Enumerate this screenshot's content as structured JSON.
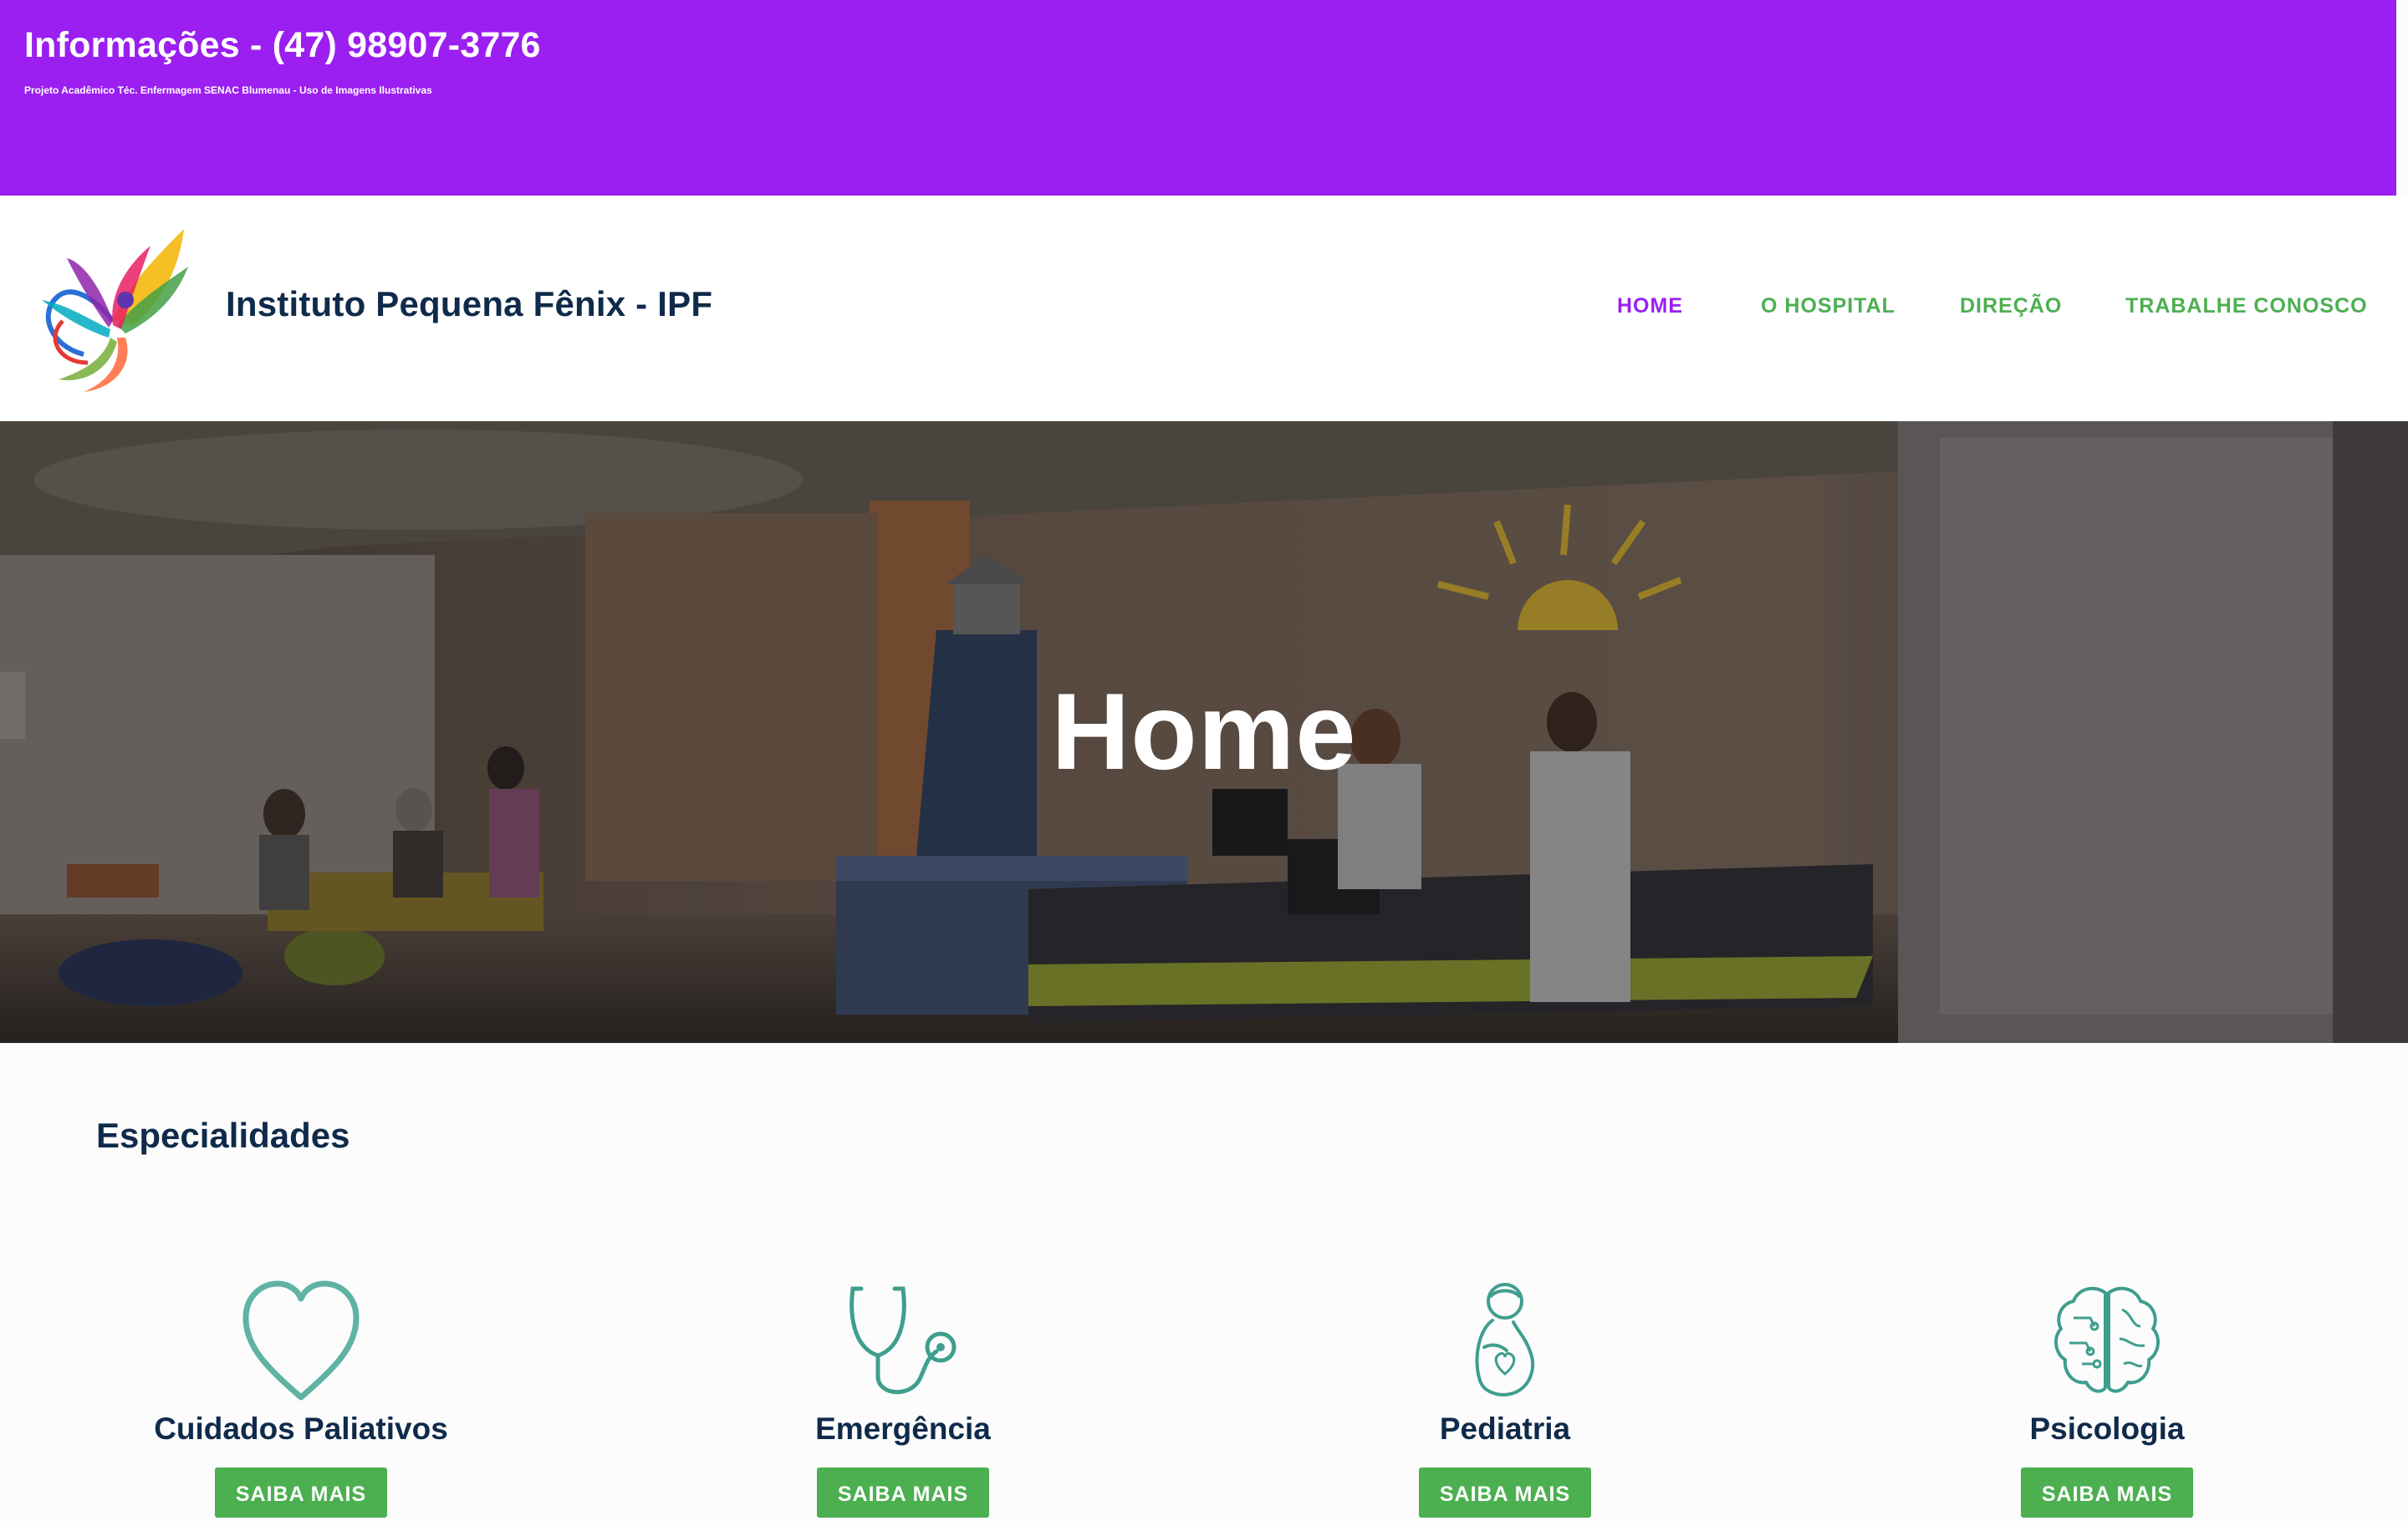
{
  "topbar": {
    "title": "Informações - (47) 98907-3776",
    "subtitle": "Projeto Acadêmico Téc. Enfermagem SENAC Blumenau - Uso de Imagens Ilustrativas"
  },
  "header": {
    "brand": "Instituto Pequena Fênix - IPF",
    "nav": [
      {
        "label": "HOME",
        "active": true
      },
      {
        "label": "O HOSPITAL",
        "active": false
      },
      {
        "label": "DIREÇÃO",
        "active": false
      },
      {
        "label": "TRABALHE CONOSCO",
        "active": false
      }
    ]
  },
  "hero": {
    "title": "Home"
  },
  "specialties": {
    "heading": "Especialidades",
    "items": [
      {
        "title": "Cuidados Paliativos",
        "button": "SAIBA MAIS",
        "icon": "heart-icon"
      },
      {
        "title": "Emergência",
        "button": "SAIBA MAIS",
        "icon": "stethoscope-icon"
      },
      {
        "title": "Pediatria",
        "button": "SAIBA MAIS",
        "icon": "pregnant-woman-icon"
      },
      {
        "title": "Psicologia",
        "button": "SAIBA MAIS",
        "icon": "brain-icon"
      }
    ]
  },
  "colors": {
    "topbar": "#9b1ff0",
    "nav_active": "#9b1ff0",
    "accent_green": "#4caf50",
    "icon_teal": "#3f9e8e",
    "heading_navy": "#0f2a4a"
  }
}
